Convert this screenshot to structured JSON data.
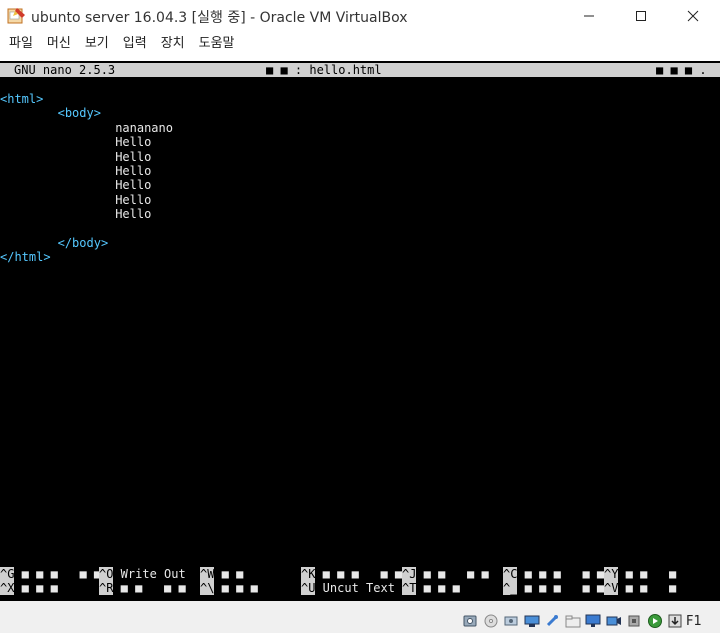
{
  "window": {
    "title": "ubunto server 16.04.3 [실행 중] - Oracle VM VirtualBox",
    "menu": [
      "파일",
      "머신",
      "보기",
      "입력",
      "장치",
      "도움말"
    ]
  },
  "nano": {
    "version": "GNU nano 2.5.3",
    "filename_display": "■ ■ : hello.html",
    "right_marks": "■ ■ ■ .",
    "lines": [
      {
        "indent": 0,
        "kind": "tag",
        "text": "<html>"
      },
      {
        "indent": 8,
        "kind": "tag",
        "text": "<body>"
      },
      {
        "indent": 16,
        "kind": "text",
        "text": "nananano"
      },
      {
        "indent": 16,
        "kind": "text",
        "text": "Hello"
      },
      {
        "indent": 16,
        "kind": "text",
        "text": "Hello"
      },
      {
        "indent": 16,
        "kind": "text",
        "text": "Hello"
      },
      {
        "indent": 16,
        "kind": "text",
        "text": "Hello"
      },
      {
        "indent": 16,
        "kind": "text",
        "text": "Hello"
      },
      {
        "indent": 16,
        "kind": "text",
        "text": "Hello"
      },
      {
        "indent": 0,
        "kind": "blank",
        "text": ""
      },
      {
        "indent": 8,
        "kind": "tag",
        "text": "</body>"
      },
      {
        "indent": 0,
        "kind": "tag",
        "text": "</html>"
      }
    ],
    "shortcuts_row1": [
      {
        "key": "^G",
        "label": "■ ■ ■   ■ ■"
      },
      {
        "key": "^O",
        "label": "Write Out"
      },
      {
        "key": "^W",
        "label": "■ ■"
      },
      {
        "key": "^K",
        "label": "■ ■ ■   ■ ■"
      },
      {
        "key": "^J",
        "label": "■ ■   ■ ■"
      },
      {
        "key": "^C",
        "label": "■ ■ ■   ■ ■"
      },
      {
        "key": "^Y",
        "label": "■ ■   ■"
      }
    ],
    "shortcuts_row2": [
      {
        "key": "^X",
        "label": "■ ■ ■"
      },
      {
        "key": "^R",
        "label": "■ ■   ■ ■"
      },
      {
        "key": "^\\",
        "label": "■ ■ ■"
      },
      {
        "key": "^U",
        "label": "Uncut Text"
      },
      {
        "key": "^T",
        "label": "■ ■ ■"
      },
      {
        "key": "^_",
        "label": "■ ■ ■   ■ ■"
      },
      {
        "key": "^V",
        "label": "■ ■   ■"
      }
    ]
  },
  "statusbar": {
    "host_key": "F1",
    "tray_icons": [
      "hard-disk-icon",
      "optical-drive-icon",
      "audio-icon",
      "network-icon",
      "usb-icon",
      "shared-folders-icon",
      "display-icon",
      "video-capture-icon",
      "cpu-icon",
      "mouse-integration-icon",
      "keyboard-icon"
    ]
  },
  "colors": {
    "terminal_bg": "#000000",
    "tag": "#55c8ff",
    "text": "#e8e8e8",
    "bar": "#d0d0d0"
  }
}
